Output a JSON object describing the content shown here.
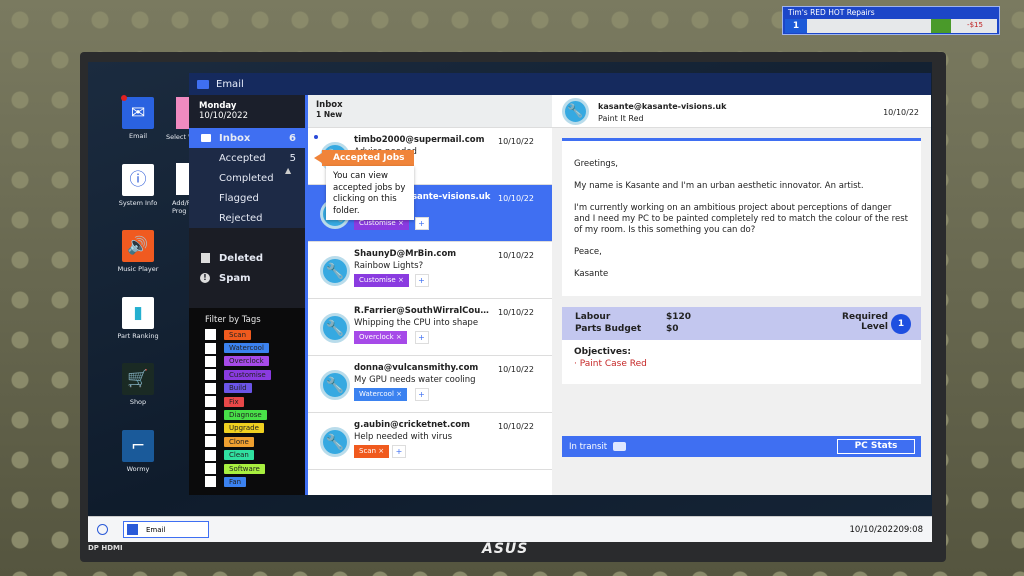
{
  "hud": {
    "company": "Tim's RED HOT Repairs",
    "level": "1",
    "money": "-$15"
  },
  "desktop": {
    "icons": [
      {
        "label": "Email",
        "icon": "envelope-icon"
      },
      {
        "label": "System Info",
        "icon": "info-icon"
      },
      {
        "label": "Music Player",
        "icon": "speaker-icon"
      },
      {
        "label": "Part Ranking",
        "icon": "bar-chart-icon"
      },
      {
        "label": "Shop",
        "icon": "cart-icon"
      },
      {
        "label": "Wormy",
        "icon": "snake-game-icon"
      }
    ],
    "partial_icons": [
      {
        "label": "Select W"
      },
      {
        "label": "Add/R Prog"
      }
    ]
  },
  "window": {
    "title": "Email"
  },
  "sidebar": {
    "day": "Monday",
    "date": "10/10/2022",
    "folders": [
      {
        "label": "Inbox",
        "count": "6"
      },
      {
        "label": "Accepted",
        "count": "5"
      },
      {
        "label": "Completed"
      },
      {
        "label": "Flagged"
      },
      {
        "label": "Rejected"
      }
    ],
    "other": [
      {
        "label": "Deleted"
      },
      {
        "label": "Spam"
      }
    ],
    "filter_title": "Filter by Tags",
    "tags": [
      {
        "label": "Scan",
        "color": "#f05a1e"
      },
      {
        "label": "Watercool",
        "color": "#3b82f0"
      },
      {
        "label": "Overclock",
        "color": "#a64ae8"
      },
      {
        "label": "Customise",
        "color": "#8a3be0"
      },
      {
        "label": "Build",
        "color": "#6b55e8"
      },
      {
        "label": "Fix",
        "color": "#e84848"
      },
      {
        "label": "Diagnose",
        "color": "#48e048"
      },
      {
        "label": "Upgrade",
        "color": "#f0d020"
      },
      {
        "label": "Clone",
        "color": "#f0a030"
      },
      {
        "label": "Clean",
        "color": "#30e0a0"
      },
      {
        "label": "Software",
        "color": "#a8f040"
      },
      {
        "label": "Fan",
        "color": "#3b82f0"
      }
    ]
  },
  "inbox": {
    "title": "Inbox",
    "new": "1 New",
    "items": [
      {
        "from": "timbo2000@supermail.com",
        "subject": "Advice needed",
        "date": "10/10/22",
        "unread": true
      },
      {
        "from": "kasante@kasante-visions.uk",
        "subject": "Paint It Red",
        "date": "10/10/22",
        "tag": "Customise",
        "tag_color": "#8a3be0",
        "selected": true
      },
      {
        "from": "ShaunyD@MrBin.com",
        "subject": "Rainbow Lights?",
        "date": "10/10/22",
        "tag": "Customise",
        "tag_color": "#8a3be0"
      },
      {
        "from": "R.Farrier@SouthWirralCountryClub.com",
        "subject": "Whipping the CPU into shape",
        "date": "10/10/22",
        "tag": "Overclock",
        "tag_color": "#a64ae8"
      },
      {
        "from": "donna@vulcansmithy.com",
        "subject": "My GPU needs water cooling",
        "date": "10/10/22",
        "tag": "Watercool",
        "tag_color": "#3b82f0"
      },
      {
        "from": "g.aubin@cricketnet.com",
        "subject": "Help needed with virus",
        "date": "10/10/22",
        "tag": "Scan",
        "tag_color": "#f05a1e"
      }
    ]
  },
  "tooltip": {
    "title": "Accepted Jobs",
    "body": "You can view accepted jobs by clicking on this folder."
  },
  "detail": {
    "from": "kasante@kasante-visions.uk",
    "subject": "Paint It Red",
    "date": "10/10/22",
    "body": [
      "Greetings,",
      "My name is Kasante and I'm an urban aesthetic innovator. An artist.",
      "I'm currently working on an ambitious project about perceptions of danger and I need my PC to be painted completely red to match the colour of the rest of my room. Is this something you can do?",
      "Peace,",
      "Kasante"
    ],
    "labour_label": "Labour",
    "labour": "$120",
    "parts_label": "Parts Budget",
    "parts": "$0",
    "required_label1": "Required",
    "required_label2": "Level",
    "required_level": "1",
    "objectives_label": "Objectives:",
    "objectives": [
      "Paint Case Red"
    ],
    "status": "In transit",
    "pc_stats": "PC Stats"
  },
  "taskbar": {
    "app": "Email",
    "datetime": "10/10/202209:08"
  },
  "monitor": {
    "brand": "ASUS",
    "ports": "DP HDMI"
  },
  "colors": {
    "accent": "#3f6ff2",
    "tooltip": "#f0843a",
    "objective": "#c62828"
  }
}
